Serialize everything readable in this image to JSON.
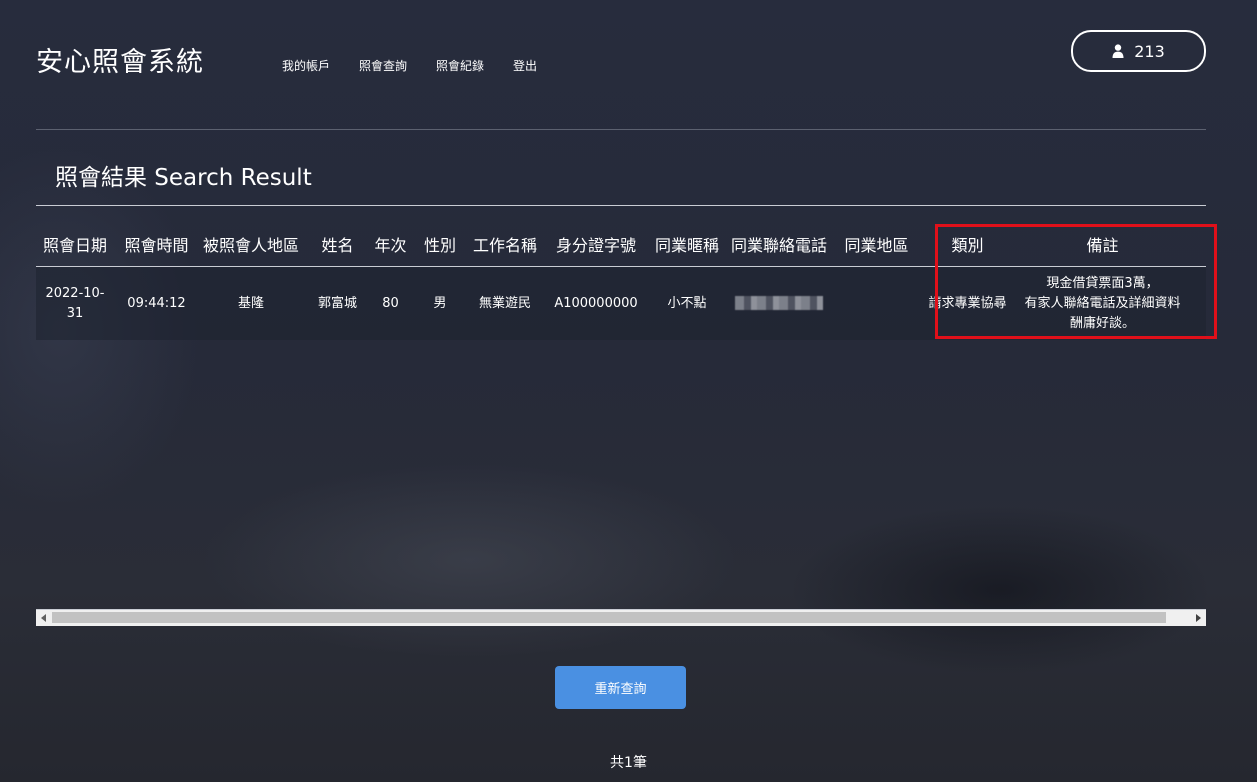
{
  "brand": "安心照會系統",
  "nav": [
    "我的帳戶",
    "照會查詢",
    "照會紀錄",
    "登出"
  ],
  "user": {
    "icon": "user-icon",
    "count": "213"
  },
  "section_title": "照會結果 Search Result",
  "table": {
    "headers": [
      "照會日期",
      "照會時間",
      "被照會人地區",
      "姓名",
      "年次",
      "性別",
      "工作名稱",
      "身分證字號",
      "同業暱稱",
      "同業聯絡電話",
      "同業地區",
      "類別",
      "備註"
    ],
    "rows": [
      {
        "date_line1": "2022-10-",
        "date_line2": "31",
        "time": "09:44:12",
        "region": "基隆",
        "name": "郭富城",
        "year": "80",
        "gender": "男",
        "job": "無業遊民",
        "id_number": "A100000000",
        "nickname": "小不點",
        "phone": "",
        "peer_region": "",
        "category": "請求專業協尋",
        "note_line1": "現金借貸票面3萬，",
        "note_line2": "有家人聯絡電話及詳細資料",
        "note_line3": "酬庸好談。"
      }
    ]
  },
  "requery_button": "重新查詢",
  "total": "共1筆",
  "highlight_color": "#e0101a",
  "accent": "#4a90e2"
}
